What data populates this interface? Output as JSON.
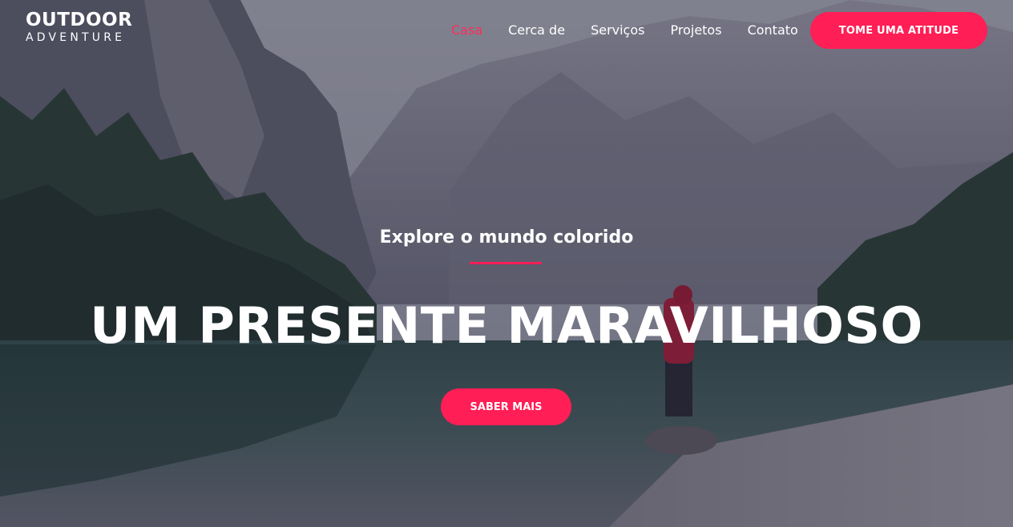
{
  "brand": {
    "name_top": "OUTDOOR",
    "name_bottom": "ADVENTURE"
  },
  "nav": {
    "items": [
      {
        "label": "Casa",
        "active": true
      },
      {
        "label": "Cerca de",
        "active": false
      },
      {
        "label": "Serviços",
        "active": false
      },
      {
        "label": "Projetos",
        "active": false
      },
      {
        "label": "Contato",
        "active": false
      }
    ],
    "cta_label": "TOME UMA ATITUDE"
  },
  "hero": {
    "subtitle": "Explore o mundo colorido",
    "title": "UM PRESENTE MARAVILHOSO",
    "button_label": "SABER MAIS",
    "background_image": "mountain-lake-hiker-photo"
  },
  "colors": {
    "accent": "#ff1e55",
    "active_nav": "#ff2c5a",
    "text": "#ffffff"
  }
}
